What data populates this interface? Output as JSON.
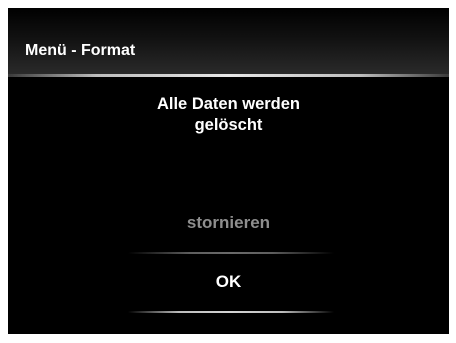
{
  "header": {
    "title": "Menü - Format"
  },
  "dialog": {
    "message_line1": "Alle Daten werden",
    "message_line2": "gelöscht"
  },
  "options": {
    "cancel_label": "stornieren",
    "ok_label": "OK",
    "selected": "OK"
  },
  "colors": {
    "background": "#000000",
    "text": "#ffffff",
    "inactive_option": "#8e8e8e",
    "frame": "#ffffff"
  }
}
